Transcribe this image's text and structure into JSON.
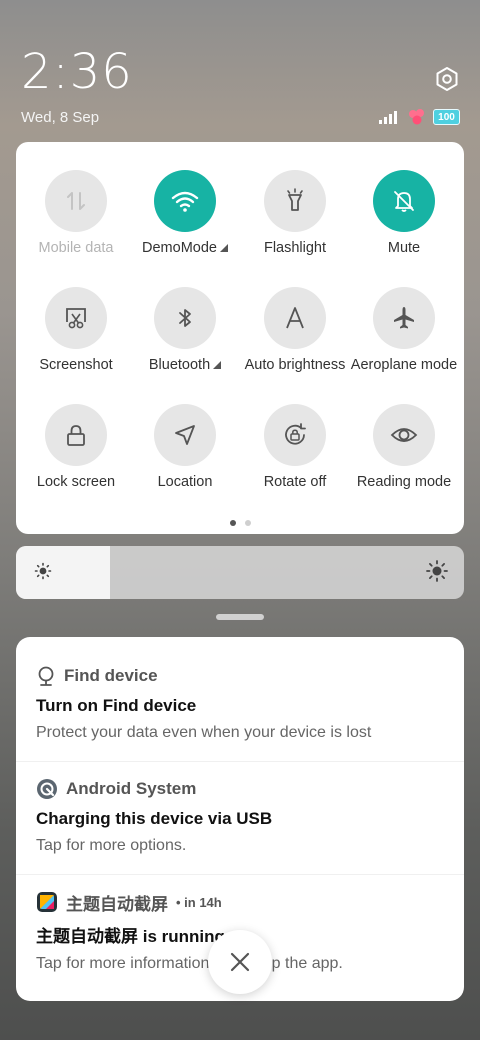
{
  "status": {
    "time": "2:36",
    "date": "Wed, 8 Sep",
    "battery": "100",
    "icons": [
      "signal-icon",
      "notification-app-icon",
      "battery-icon"
    ]
  },
  "quick_settings": {
    "tiles": [
      {
        "name": "mobile-data",
        "label": "Mobile data",
        "icon": "mobile-data-icon",
        "active": false,
        "disabled": true
      },
      {
        "name": "wifi",
        "label": "DemoMode",
        "icon": "wifi-icon",
        "active": true,
        "expandable": true
      },
      {
        "name": "flashlight",
        "label": "Flashlight",
        "icon": "flashlight-icon",
        "active": false
      },
      {
        "name": "mute",
        "label": "Mute",
        "icon": "bell-off-icon",
        "active": true
      },
      {
        "name": "screenshot",
        "label": "Screenshot",
        "icon": "screenshot-icon",
        "active": false
      },
      {
        "name": "bluetooth",
        "label": "Bluetooth",
        "icon": "bluetooth-icon",
        "active": false,
        "expandable": true
      },
      {
        "name": "auto-brightness",
        "label": "Auto brightness",
        "icon": "auto-brightness-icon",
        "active": false
      },
      {
        "name": "aeroplane-mode",
        "label": "Aeroplane mode",
        "icon": "airplane-icon",
        "active": false
      },
      {
        "name": "lock-screen",
        "label": "Lock screen",
        "icon": "lock-icon",
        "active": false
      },
      {
        "name": "location",
        "label": "Location",
        "icon": "location-icon",
        "active": false
      },
      {
        "name": "rotate-off",
        "label": "Rotate off",
        "icon": "rotate-lock-icon",
        "active": false
      },
      {
        "name": "reading-mode",
        "label": "Reading mode",
        "icon": "eye-icon",
        "active": false
      }
    ],
    "page_count": 2,
    "current_page": 1
  },
  "brightness": {
    "level_percent": 21
  },
  "notifications": [
    {
      "app": "Find device",
      "icon": "find-device-icon",
      "time": "",
      "title": "Turn on Find device",
      "body": "Protect your data even when your device is lost"
    },
    {
      "app": "Android System",
      "icon": "android-system-icon",
      "time": "",
      "title": "Charging this device via USB",
      "body": "Tap for more options."
    },
    {
      "app": "主题自动截屏",
      "icon": "app-icon",
      "time": "• in 14h",
      "title": "主题自动截屏 is running",
      "body": "Tap for more information or to stop the app."
    }
  ],
  "colors": {
    "accent": "#17b3a4",
    "tile_off": "#e6e6e6"
  }
}
